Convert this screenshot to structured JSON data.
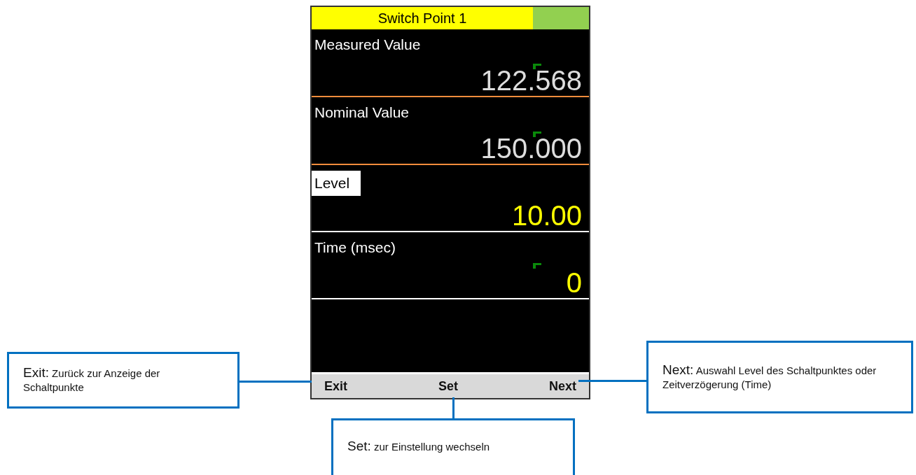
{
  "screen": {
    "title": "Switch Point 1",
    "fields": [
      {
        "kind": "readout",
        "label": "Measured Value",
        "value": "122.568",
        "selected": false,
        "cursor": true
      },
      {
        "kind": "readout",
        "label": "Nominal Value",
        "value": "150.000",
        "selected": false,
        "cursor": true
      },
      {
        "kind": "setting",
        "label": "Level",
        "value": "10.00",
        "selected": true,
        "cursor": false
      },
      {
        "kind": "setting",
        "label": "Time (msec)",
        "value": "0",
        "selected": false,
        "cursor": true
      }
    ],
    "softkeys": [
      "Exit",
      "Set",
      "Next"
    ]
  },
  "callouts": [
    {
      "key": "Exit:",
      "text": "Zurück zur Anzeige der Schaltpunkte"
    },
    {
      "key": "Set:",
      "text": "zur Einstellung wechseln"
    },
    {
      "key": "Next:",
      "text": "Auswahl Level des Schaltpunktes oder Zeitverzögerung (Time)"
    }
  ]
}
